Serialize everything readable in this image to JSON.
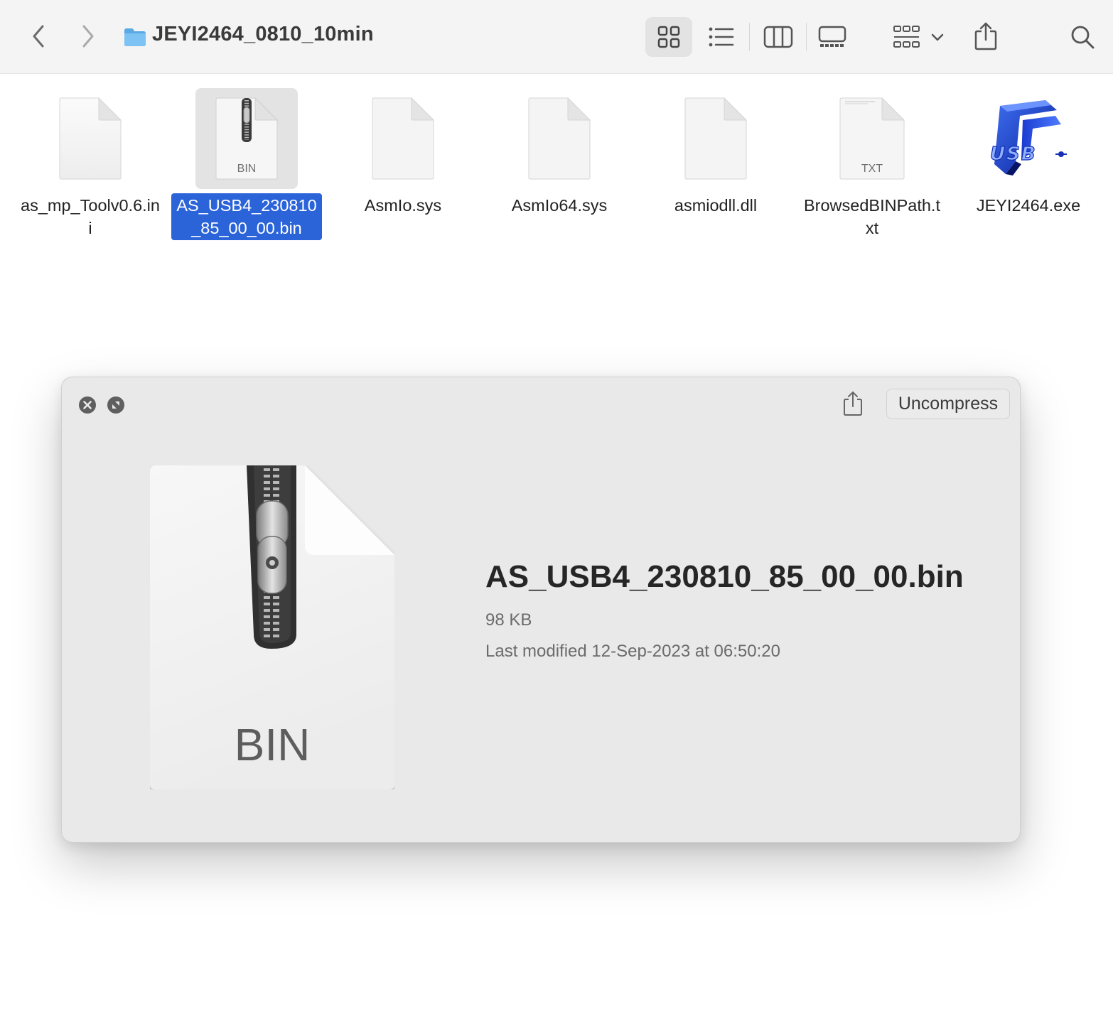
{
  "window": {
    "title": "JEYI2464_0810_10min",
    "folder_icon": "folder-icon"
  },
  "toolbar": {
    "back_icon": "chevron-left-icon",
    "forward_icon": "chevron-right-icon",
    "views": [
      "icons",
      "list",
      "columns",
      "gallery"
    ],
    "active_view": "icons",
    "group_icon": "group-grid-icon",
    "share_icon": "share-icon",
    "search_icon": "search-icon"
  },
  "files": [
    {
      "name": "as_mp_Toolv0.6.ini",
      "kind": "blank"
    },
    {
      "name": "AS_USB4_230810_85_00_00.bin",
      "kind": "zip",
      "tag": "BIN",
      "selected": true
    },
    {
      "name": "AsmIo.sys",
      "kind": "blank"
    },
    {
      "name": "AsmIo64.sys",
      "kind": "blank"
    },
    {
      "name": "asmiodll.dll",
      "kind": "blank"
    },
    {
      "name": "BrowsedBINPath.txt",
      "kind": "text",
      "tag": "TXT"
    },
    {
      "name": "JEYI2464.exe",
      "kind": "app",
      "app_label": "USB"
    }
  ],
  "quicklook": {
    "uncompress_label": "Uncompress",
    "file_name": "AS_USB4_230810_85_00_00.bin",
    "size": "98 KB",
    "modified": "Last modified 12-Sep-2023 at 06:50:20",
    "icon_tag": "BIN"
  },
  "colors": {
    "selection": "#2b63d9",
    "toolbar_bg": "#f3f4f3",
    "panel_bg": "#e8e9e8",
    "folder": "#5fb1ec"
  }
}
